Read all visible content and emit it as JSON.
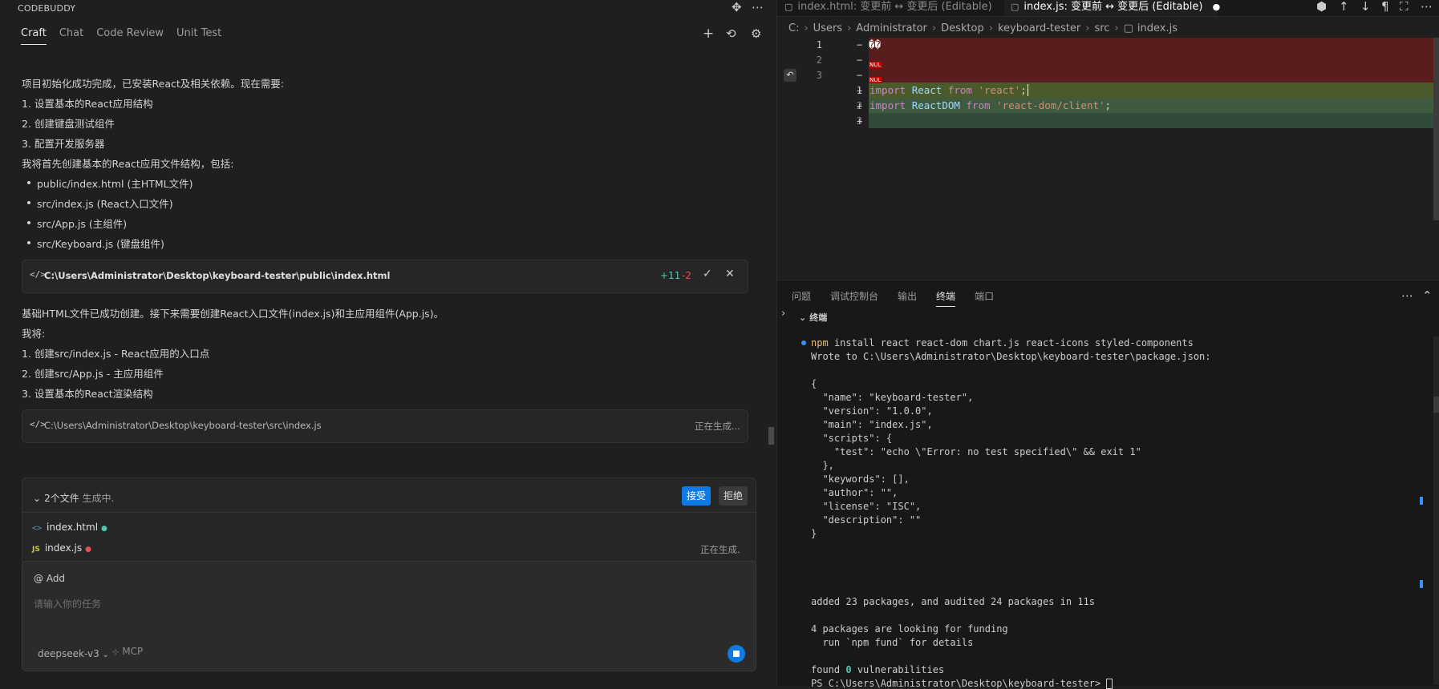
{
  "sidebar": {
    "title": "CODEBUDDY",
    "tabs": [
      "Craft",
      "Chat",
      "Code Review",
      "Unit Test"
    ]
  },
  "chat": {
    "msg1": {
      "intro": "项目初始化成功完成，已安装React及相关依赖。现在需要:",
      "steps": [
        "1. 设置基本的React应用结构",
        "2. 创建键盘测试组件",
        "3. 配置开发服务器"
      ],
      "plan": "我将首先创建基本的React应用文件结构，包括:",
      "bullets": [
        "public/index.html (主HTML文件)",
        "src/index.js (React入口文件)",
        "src/App.js (主组件)",
        "src/Keyboard.js (键盘组件)"
      ]
    },
    "card1": {
      "path": "C:\\Users\\Administrator\\Desktop\\keyboard-tester\\public\\index.html",
      "added": "+11",
      "removed": "-2"
    },
    "msg2": {
      "intro": "基础HTML文件已成功创建。接下来需要创建React入口文件(index.js)和主应用组件(App.js)。",
      "lead": "我将:",
      "steps": [
        "1. 创建src/index.js - React应用的入口点",
        "2. 创建src/App.js - 主应用组件",
        "3. 设置基本的React渲染结构"
      ]
    },
    "card2": {
      "path": "C:\\Users\\Administrator\\Desktop\\keyboard-tester\\src\\index.js",
      "status": "正在生成..."
    }
  },
  "changes": {
    "title": "2个文件",
    "subtitle": "生成中.",
    "accept": "接受",
    "reject": "拒绝",
    "files": [
      {
        "name": "index.html",
        "type": "html",
        "status": ""
      },
      {
        "name": "index.js",
        "type": "js",
        "status": "正在生成."
      }
    ]
  },
  "input": {
    "add_label": "@ Add",
    "placeholder": "请输入你的任务",
    "model": "deepseek-v3",
    "mcp": "MCP"
  },
  "editor": {
    "tabs": [
      {
        "label": "index.html: 变更前 ↔ 变更后 (Editable)",
        "active": false
      },
      {
        "label": "index.js: 变更前 ↔ 变更后 (Editable)",
        "active": true
      }
    ],
    "breadcrumbs": [
      "C:",
      "Users",
      "Administrator",
      "Desktop",
      "keyboard-tester",
      "src",
      "index.js"
    ],
    "left_line_numbers": [
      "1",
      "2",
      "3"
    ],
    "right_line_numbers": [
      "1",
      "2",
      "3"
    ],
    "deleted_glyphs": "��",
    "nul_label": "NUL",
    "code": {
      "l1_kw": "import",
      "l1_id": "React",
      "l1_from": "from",
      "l1_str": "'react'",
      "l1_end": ";",
      "l2_kw": "import",
      "l2_id": "ReactDOM",
      "l2_from": "from",
      "l2_str": "'react-dom/client'",
      "l2_end": ";"
    }
  },
  "panel": {
    "tabs": [
      "问题",
      "调试控制台",
      "输出",
      "终端",
      "端口"
    ],
    "active_tab": "终端",
    "terminal_title": "终端",
    "npm": "npm",
    "command": " install react react-dom chart.js react-icons styled-components",
    "lines": [
      "Wrote to C:\\Users\\Administrator\\Desktop\\keyboard-tester\\package.json:",
      "",
      "{",
      "  \"name\": \"keyboard-tester\",",
      "  \"version\": \"1.0.0\",",
      "  \"main\": \"index.js\",",
      "  \"scripts\": {",
      "    \"test\": \"echo \\\"Error: no test specified\\\" && exit 1\"",
      "  },",
      "  \"keywords\": [],",
      "  \"author\": \"\",",
      "  \"license\": \"ISC\",",
      "  \"description\": \"\"",
      "}"
    ],
    "added": "added 23 packages, and audited 24 packages in 11s",
    "funding1": "4 packages are looking for funding",
    "funding2": "  run `npm fund` for details",
    "found_pre": "found ",
    "found_zero": "0",
    "found_post": " vulnerabilities",
    "prompt": "PS C:\\Users\\Administrator\\Desktop\\keyboard-tester> "
  }
}
